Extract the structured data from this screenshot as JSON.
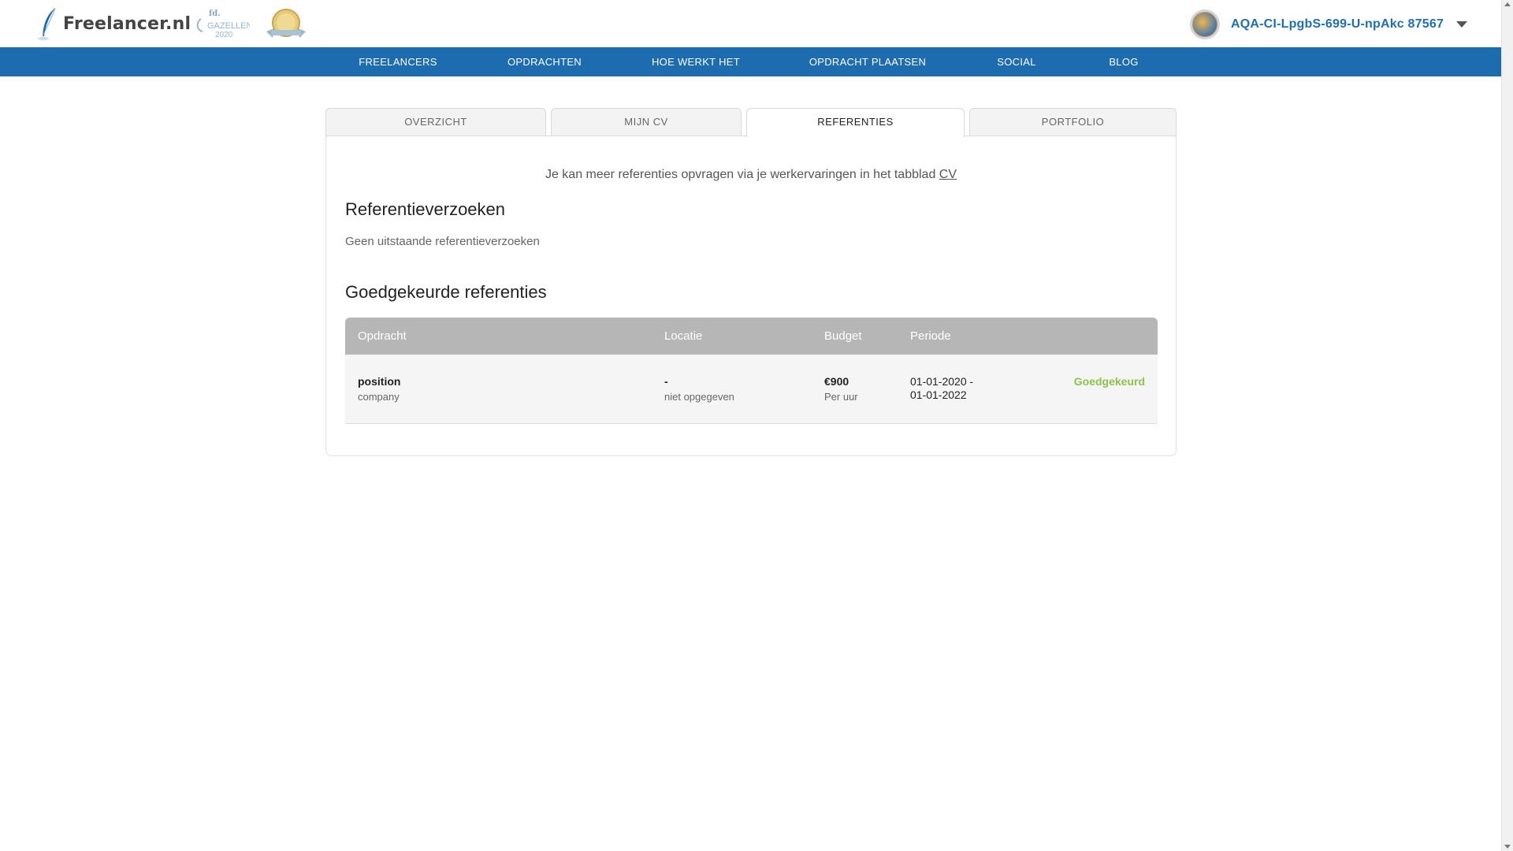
{
  "header": {
    "logo_text": "Freelancer.nl",
    "badge_text": "GAZELLEN",
    "badge_year": "2020",
    "username": "AQA-CI-LpgbS-699-U-npAkc 87567"
  },
  "nav": {
    "items": [
      "FREELANCERS",
      "OPDRACHTEN",
      "HOE WERKT HET",
      "OPDRACHT PLAATSEN",
      "SOCIAL",
      "BLOG"
    ]
  },
  "tabs": [
    {
      "label": "OVERZICHT",
      "active": false
    },
    {
      "label": "MIJN CV",
      "active": false
    },
    {
      "label": "REFERENTIES",
      "active": true
    },
    {
      "label": "PORTFOLIO",
      "active": false
    }
  ],
  "content": {
    "info_text": "Je kan meer referenties opvragen via je werkervaringen in het tabblad",
    "info_link": "CV",
    "requests_title": "Referentieverzoeken",
    "requests_empty": "Geen uitstaande referentieverzoeken",
    "approved_title": "Goedgekeurde referenties"
  },
  "table": {
    "headers": [
      "Opdracht",
      "Locatie",
      "Budget",
      "Periode"
    ],
    "rows": [
      {
        "position": "position",
        "company": "company",
        "location": "-",
        "location_sub": "niet opgegeven",
        "budget": "€900",
        "budget_sub": "Per uur",
        "period_start": "01-01-2020 -",
        "period_end": "01-01-2022",
        "status": "Goedgekeurd"
      }
    ]
  },
  "colors": {
    "brand_blue": "#1e6cb0",
    "status_green": "#8bc34a",
    "table_header": "#b6b6b6"
  }
}
